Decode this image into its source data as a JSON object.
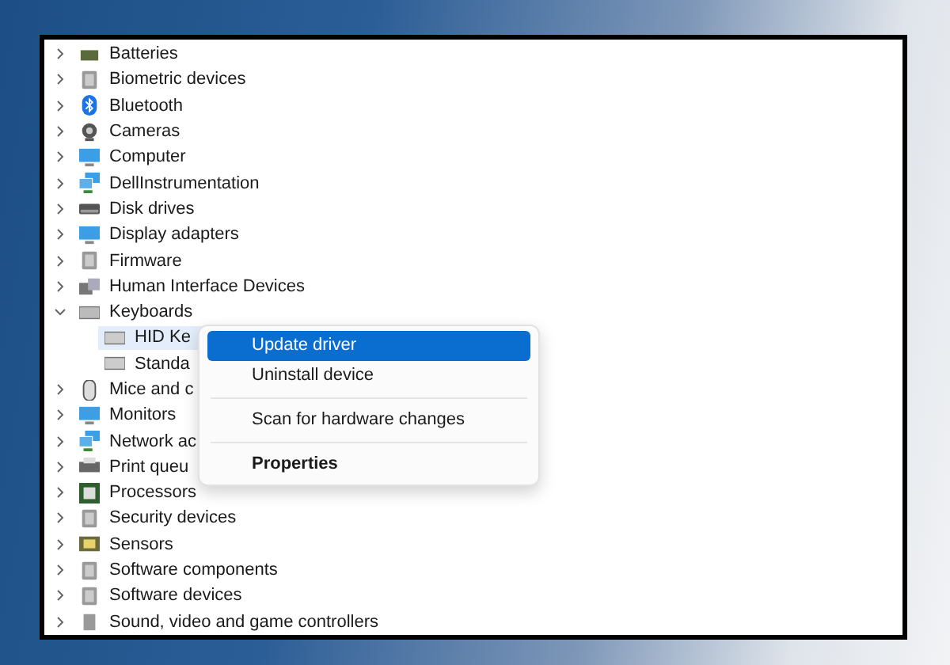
{
  "tree": [
    {
      "label": "Batteries",
      "expanded": false
    },
    {
      "label": "Biometric devices",
      "expanded": false
    },
    {
      "label": "Bluetooth",
      "expanded": false
    },
    {
      "label": "Cameras",
      "expanded": false
    },
    {
      "label": "Computer",
      "expanded": false
    },
    {
      "label": "DellInstrumentation",
      "expanded": false
    },
    {
      "label": "Disk drives",
      "expanded": false
    },
    {
      "label": "Display adapters",
      "expanded": false
    },
    {
      "label": "Firmware",
      "expanded": false
    },
    {
      "label": "Human Interface Devices",
      "expanded": false
    },
    {
      "label": "Keyboards",
      "expanded": true,
      "children": [
        {
          "label": "HID Ke",
          "selected": true
        },
        {
          "label": "Standa",
          "selected": false
        }
      ]
    },
    {
      "label": "Mice and c",
      "expanded": false
    },
    {
      "label": "Monitors",
      "expanded": false
    },
    {
      "label": "Network ac",
      "expanded": false
    },
    {
      "label": "Print queu",
      "expanded": false
    },
    {
      "label": "Processors",
      "expanded": false
    },
    {
      "label": "Security devices",
      "expanded": false
    },
    {
      "label": "Sensors",
      "expanded": false
    },
    {
      "label": "Software components",
      "expanded": false
    },
    {
      "label": "Software devices",
      "expanded": false
    },
    {
      "label": "Sound, video and game controllers",
      "expanded": false
    }
  ],
  "context_menu": [
    {
      "kind": "item",
      "label": "Update driver",
      "selected": true,
      "bold": false
    },
    {
      "kind": "item",
      "label": "Uninstall device",
      "selected": false,
      "bold": false
    },
    {
      "kind": "separator"
    },
    {
      "kind": "item",
      "label": "Scan for hardware changes",
      "selected": false,
      "bold": false
    },
    {
      "kind": "separator"
    },
    {
      "kind": "item",
      "label": "Properties",
      "selected": false,
      "bold": true
    }
  ]
}
